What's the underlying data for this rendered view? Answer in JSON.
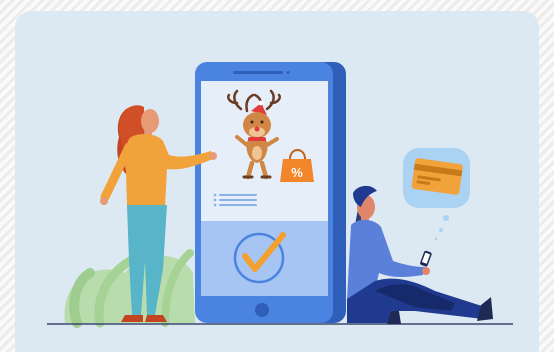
{
  "illustration": {
    "shopping_bag_icon": "shopping-bag-percent",
    "bag_symbol": "%",
    "phone_status": "payment-confirmed",
    "colors": {
      "phone_frame": "#3f79d8",
      "phone_screen_top": "#e4ecf9",
      "phone_screen_bottom": "#9ec0f2",
      "check": "#f4a02e",
      "woman_shirt": "#f2a23a",
      "man_shirt": "#5a80d9",
      "man_pants": "#1f3a8f",
      "card": "#f2a23a",
      "bubble": "#a9d2f3"
    }
  }
}
